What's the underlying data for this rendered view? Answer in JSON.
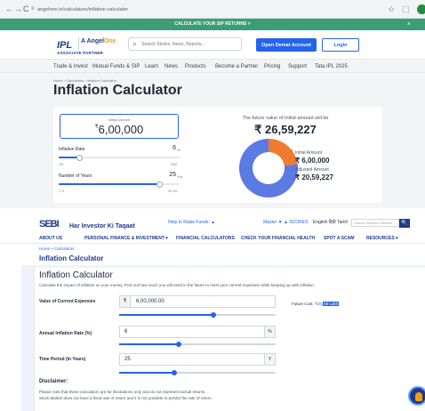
{
  "browser": {
    "back": "←",
    "forward": "→",
    "reload": "C",
    "tune_icon": "≡",
    "url": "angelone.in/calculators/inflation-calculator",
    "star": "☆",
    "ext": "⬚"
  },
  "angel": {
    "promo_text": "CALCULATE YOUR SIP RETURNS >",
    "promo_close": "×",
    "ipl_logo": "IPL",
    "brand_prefix": "A ",
    "brand_angel": "Angel",
    "brand_one": "One",
    "associate": "ASSOCIATE PARTNER",
    "search_placeholder": "Search Stocks, News, Reports...",
    "open_demat": "Open Demat Account",
    "login": "Login",
    "nav": [
      "Trade & Invest",
      "Mutual Funds & SIP",
      "Learn",
      "News",
      "Products",
      "Become a Partner",
      "Pricing",
      "Support",
      "Tata IPL 2025"
    ],
    "breadcrumb": "Home › Calculators › Inflation Calculator",
    "title": "Inflation Calculator",
    "initial_amount_label": "Initial Amount",
    "initial_amount": "6,00,000",
    "currency": "₹",
    "inflation_label": "Inflation Rate",
    "inflation_value": "6",
    "inflation_unit": "%",
    "inflation_min": "1%",
    "inflation_max": "30%",
    "inflation_fraction": 0.17,
    "years_label": "Number of Years",
    "years_value": "25",
    "years_unit": "Yrs",
    "years_min": "1 Yr",
    "years_max": "30 Yrs",
    "years_fraction": 0.83,
    "future_text": "The future value of Initial amount will be",
    "future_value": "₹ 26,59,227",
    "legend_initial_label": "Initial Amount",
    "legend_initial_value": "₹ 6,00,000",
    "legend_adjusted_label": "Adjusted Amount",
    "legend_adjusted_value": "₹ 20,59,227",
    "colors": {
      "initial": "#f07b2e",
      "adjusted": "#5b7be3",
      "accent": "#2563eb",
      "promo": "#3a9d76"
    },
    "donut_data": {
      "initial": 600000,
      "adjusted": 2059227
    }
  },
  "sebi": {
    "logo": "SEBI",
    "sub": "Har Investor Ki Taqaat",
    "help": "Help to Raise Funds: ▲",
    "tools": "Master ▼  ▲ SCORES",
    "lang": "English  हिंदी  Tamil",
    "search_placeholder": "Search Investor Website",
    "search_btn": "🔍",
    "nav": [
      "ABOUT US",
      "PERSONAL FINANCE & INVESTMENT ▾",
      "FINANCIAL CALCULATORS",
      "CHECK YOUR FINANCIAL HEALTH",
      "SPOT A SCAM",
      "RESOURCES ▾"
    ],
    "breadcrumb": "Home » Calculators",
    "title": "Inflation Calculator",
    "card_title": "Inflation Calculator",
    "description": "Calculate the impact of inflation on your money. Find out how much you will need in the future to meet your current expenses while keeping up with inflation.",
    "expense_label": "Value of Current Expenses",
    "expense_currency": "₹",
    "expense_value": "6,00,000.00",
    "expense_fraction": 0.6,
    "rate_label": "Annual Inflation Rate (%)",
    "rate_value": "6",
    "rate_suffix": "%",
    "rate_fraction": 0.38,
    "period_label": "Time Period (In Years)",
    "period_value": "25",
    "period_suffix": "Y",
    "period_fraction": 0.35,
    "future_cost_label": "Future Cost:",
    "future_cost_prefix": "₹26,",
    "future_cost_value": "59 Lakh",
    "disclaimer_heading": "Disclaimer:",
    "disclaimer_line1": "Please note that these calculators are for illustrations only and do not represent actual returns.",
    "disclaimer_line2": "Stock Market does not have a fixed rate of return and it is not possible to predict the rate of return."
  }
}
